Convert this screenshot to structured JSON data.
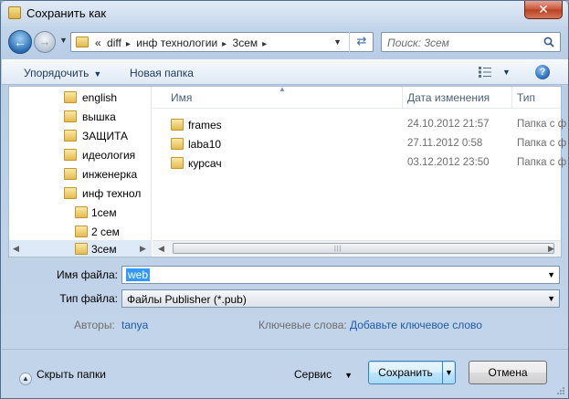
{
  "window": {
    "title": "Сохранить как",
    "close_label": "✕"
  },
  "address_bar": {
    "overflow": "«",
    "path": [
      "diff",
      "инф технологии",
      "3сем"
    ]
  },
  "search": {
    "placeholder": "Поиск: 3сем"
  },
  "toolbar": {
    "organize_label": "Упорядочить",
    "new_folder_label": "Новая папка",
    "help_label": "?"
  },
  "nav_tree": {
    "items": [
      {
        "label": "english",
        "level": 0
      },
      {
        "label": "вышка",
        "level": 0
      },
      {
        "label": "ЗАЩИТА",
        "level": 0
      },
      {
        "label": "идеология",
        "level": 0
      },
      {
        "label": "инженерка",
        "level": 0
      },
      {
        "label": "инф технол",
        "level": 0
      },
      {
        "label": "1сем",
        "level": 1
      },
      {
        "label": "2 сем",
        "level": 1
      },
      {
        "label": "3сем",
        "level": 1,
        "selected": true
      }
    ]
  },
  "file_list": {
    "columns": {
      "name": "Имя",
      "date": "Дата изменения",
      "type": "Тип"
    },
    "rows": [
      {
        "name": "frames",
        "date": "24.10.2012 21:57",
        "type": "Папка с ф"
      },
      {
        "name": "laba10",
        "date": "27.11.2012 0:58",
        "type": "Папка с ф"
      },
      {
        "name": "курсач",
        "date": "03.12.2012 23:50",
        "type": "Папка с ф"
      }
    ]
  },
  "form": {
    "filename_label": "Имя файла:",
    "filename_value": "web",
    "filetype_label": "Тип файла:",
    "filetype_value": "Файлы Publisher (*.pub)",
    "authors_label": "Авторы:",
    "authors_value": "tanya",
    "keywords_label": "Ключевые слова:",
    "keywords_value": "Добавьте ключевое слово"
  },
  "footer": {
    "hide_folders_label": "Скрыть папки",
    "service_label": "Сервис",
    "save_label": "Сохранить",
    "cancel_label": "Отмена"
  },
  "colors": {
    "selection": "#3399ff",
    "link": "#1f5ba8",
    "toolbar_text": "#1e395b"
  }
}
